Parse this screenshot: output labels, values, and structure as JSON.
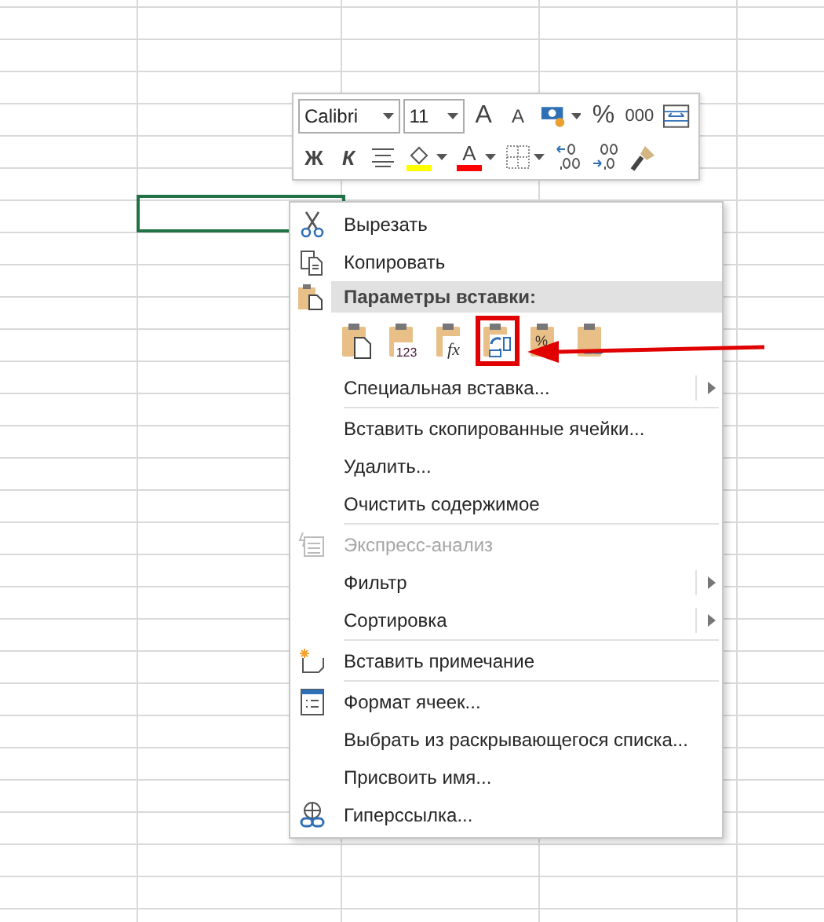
{
  "toolbar": {
    "font": "Calibri",
    "size": "11",
    "row1": [
      {
        "kind": "grow",
        "label": "A"
      },
      {
        "kind": "shrink",
        "label": "A"
      },
      {
        "kind": "numformat"
      },
      {
        "kind": "text",
        "label": "%"
      },
      {
        "kind": "text",
        "label": "000"
      },
      {
        "kind": "wrap"
      }
    ],
    "row2": [
      {
        "kind": "bold",
        "label": "Ж"
      },
      {
        "kind": "italic",
        "label": "К"
      },
      {
        "kind": "align"
      },
      {
        "kind": "fill",
        "color": "#ffff00"
      },
      {
        "kind": "fontcolor",
        "label": "A",
        "color": "#ff0000"
      },
      {
        "kind": "borders"
      },
      {
        "kind": "incdec"
      },
      {
        "kind": "decdec"
      },
      {
        "kind": "painter"
      }
    ]
  },
  "menu": {
    "items": [
      {
        "kind": "item",
        "label": "Вырезать",
        "disabled": false,
        "submenu": false
      },
      {
        "kind": "item",
        "label": "Копировать",
        "disabled": false,
        "submenu": false
      },
      {
        "kind": "header",
        "label": "Параметры вставки:"
      },
      {
        "kind": "paste",
        "options": [
          {
            "highlighted": false
          },
          {
            "text": "123",
            "highlighted": false
          },
          {
            "text": "fx",
            "highlighted": false
          },
          {
            "highlighted": true
          },
          {
            "text": "%",
            "highlighted": false
          },
          {
            "highlighted": false
          }
        ]
      },
      {
        "kind": "item",
        "label": "Специальная вставка...",
        "disabled": false,
        "submenu": true
      },
      {
        "kind": "separator"
      },
      {
        "kind": "item",
        "label": "Вставить скопированные ячейки...",
        "disabled": false,
        "submenu": false
      },
      {
        "kind": "item",
        "label": "Удалить...",
        "disabled": false,
        "submenu": false
      },
      {
        "kind": "item",
        "label": "Очистить содержимое",
        "disabled": false,
        "submenu": false
      },
      {
        "kind": "separator"
      },
      {
        "kind": "item",
        "label": "Экспресс-анализ",
        "disabled": true,
        "submenu": false
      },
      {
        "kind": "item",
        "label": "Фильтр",
        "disabled": false,
        "submenu": true
      },
      {
        "kind": "item",
        "label": "Сортировка",
        "disabled": false,
        "submenu": true
      },
      {
        "kind": "separator"
      },
      {
        "kind": "item",
        "label": "Вставить примечание",
        "disabled": false,
        "submenu": false
      },
      {
        "kind": "separator"
      },
      {
        "kind": "item",
        "label": "Формат ячеек...",
        "disabled": false,
        "submenu": false
      },
      {
        "kind": "item",
        "label": "Выбрать из раскрывающегося списка...",
        "disabled": false,
        "submenu": false
      },
      {
        "kind": "item",
        "label": "Присвоить имя...",
        "disabled": false,
        "submenu": false
      },
      {
        "kind": "item",
        "label": "Гиперссылка...",
        "disabled": false,
        "submenu": false
      }
    ]
  }
}
